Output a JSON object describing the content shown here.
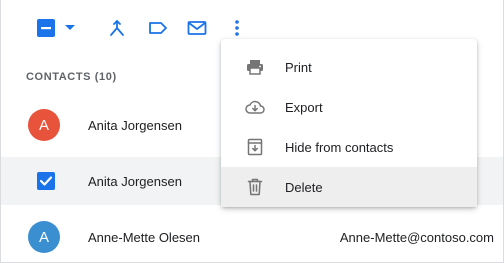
{
  "colors": {
    "accent": "#1a73e8",
    "avatar_orange": "#e8533b",
    "avatar_blue": "#3a8fd1",
    "selected_row": "#f1f3f4",
    "menu_hover": "#eeeeee"
  },
  "toolbar": {
    "icons": [
      "select-all-checkbox-icon",
      "dropdown-arrow-icon",
      "merge-icon",
      "label-icon",
      "email-icon",
      "more-vert-icon"
    ]
  },
  "contacts": {
    "section_title": "CONTACTS (10)",
    "rows": [
      {
        "initial": "A",
        "name": "Anita Jorgensen",
        "email": "",
        "selected": false
      },
      {
        "initial": "",
        "name": "Anita Jorgensen",
        "email": "",
        "selected": true
      },
      {
        "initial": "A",
        "name": "Anne-Mette Olesen",
        "email": "Anne-Mette@contoso.com",
        "selected": false
      }
    ]
  },
  "menu": {
    "items": [
      {
        "label": "Print",
        "icon": "print-icon"
      },
      {
        "label": "Export",
        "icon": "cloud-download-icon"
      },
      {
        "label": "Hide from contacts",
        "icon": "archive-icon"
      },
      {
        "label": "Delete",
        "icon": "trash-icon"
      }
    ]
  }
}
